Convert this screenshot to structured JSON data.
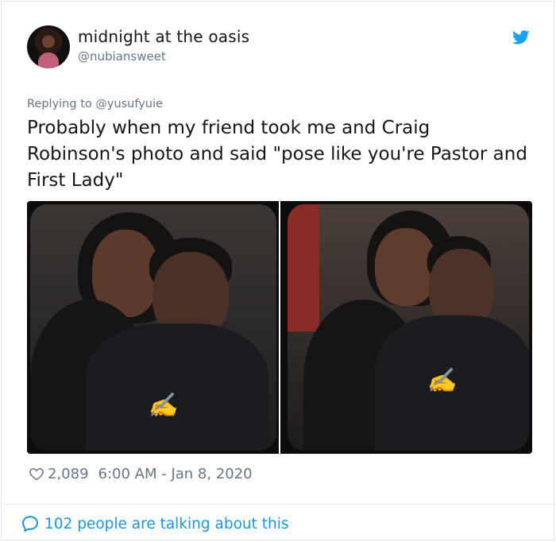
{
  "author": {
    "display_name": "midnight at the oasis",
    "handle": "@nubiansweet",
    "avatar_icon": "profile-photo"
  },
  "reply": {
    "prefix": "Replying to",
    "mention": "@yusufyuie"
  },
  "tweet": {
    "text": "Probably when my friend took me and Craig Robinson's photo and said \"pose like you're Pastor and First Lady\""
  },
  "media": {
    "photos": [
      {
        "description_icon": "photo-left"
      },
      {
        "description_icon": "photo-right"
      }
    ]
  },
  "meta": {
    "like_count": "2,089",
    "timestamp": "6:00 AM - Jan 8, 2020"
  },
  "footer": {
    "talk_text": "102 people are talking about this"
  },
  "colors": {
    "twitter_blue": "#1da1f2",
    "link_blue": "#1b95e0",
    "secondary_text": "#657786",
    "primary_text": "#14171a"
  }
}
